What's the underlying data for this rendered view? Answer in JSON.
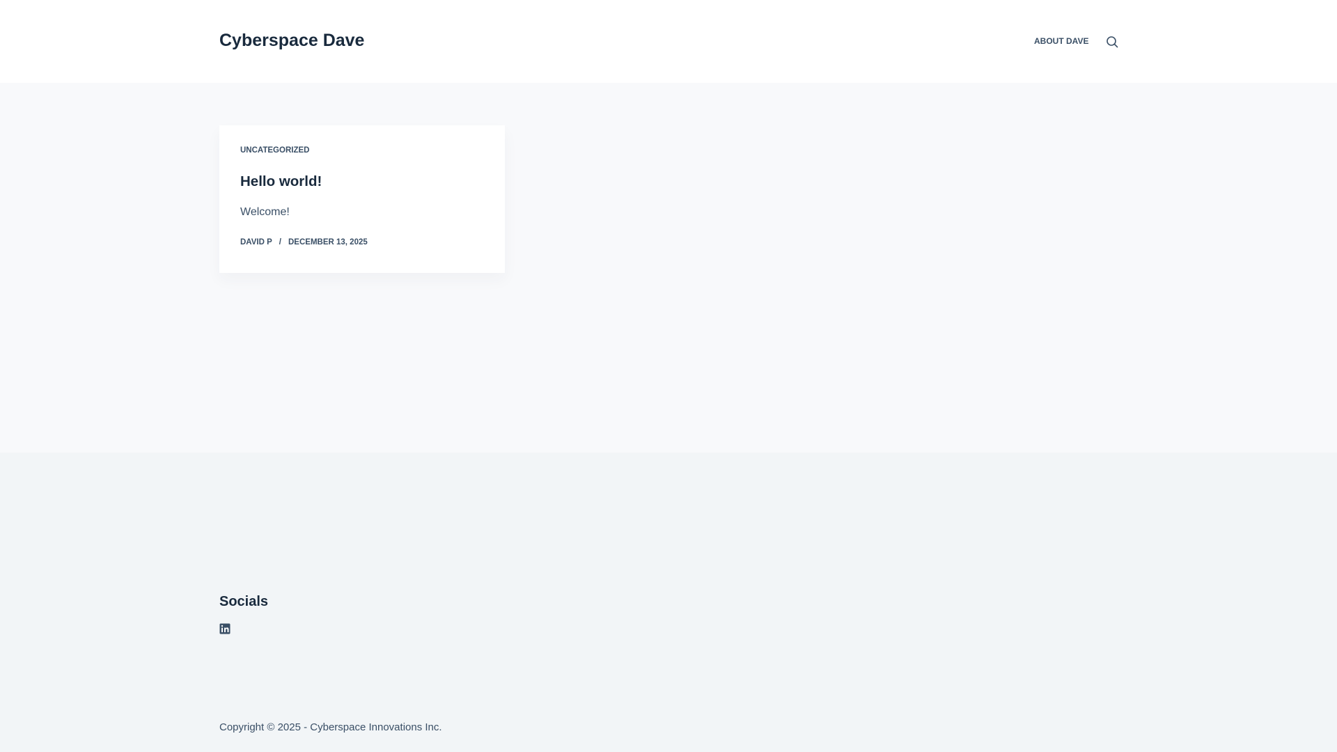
{
  "header": {
    "site_title": "Cyberspace Dave",
    "nav": [
      {
        "label": "ABOUT DAVE"
      }
    ]
  },
  "post": {
    "category": "UNCATEGORIZED",
    "title": "Hello world!",
    "excerpt": "Welcome!",
    "author": "DAVID P",
    "separator": "/",
    "date": "DECEMBER 13, 2025"
  },
  "footer": {
    "socials_heading": "Socials",
    "copyright": "Copyright © 2025 - Cyberspace Innovations Inc."
  },
  "icons": [
    "search-icon",
    "linkedin-icon"
  ]
}
